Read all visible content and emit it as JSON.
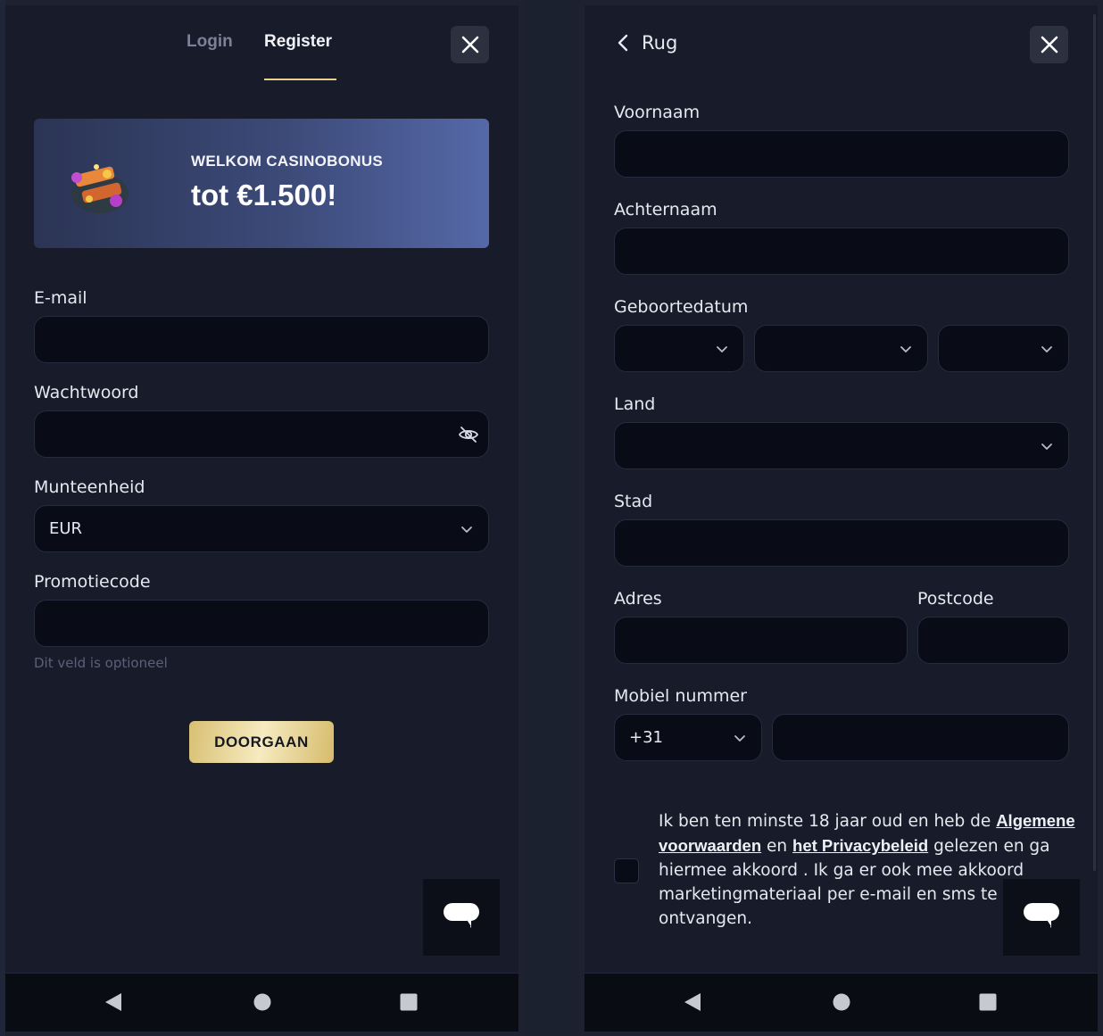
{
  "left": {
    "tabs": [
      {
        "label": "Login",
        "active": false
      },
      {
        "label": "Register",
        "active": true
      }
    ],
    "banner": {
      "subtitle": "WELKOM CASINOBONUS",
      "title": "tot €1.500!"
    },
    "fields": {
      "email_label": "E-mail",
      "password_label": "Wachtwoord",
      "currency_label": "Munteenheid",
      "currency_value": "EUR",
      "promo_label": "Promotiecode",
      "promo_hint": "Dit veld is optioneel"
    },
    "cta_label": "DOORGAAN"
  },
  "right": {
    "back_label": "Rug",
    "fields": {
      "first_name_label": "Voornaam",
      "last_name_label": "Achternaam",
      "dob_label": "Geboortedatum",
      "country_label": "Land",
      "city_label": "Stad",
      "address_label": "Adres",
      "postcode_label": "Postcode",
      "mobile_label": "Mobiel nummer",
      "dial_code": "+31"
    },
    "terms": {
      "part1": "Ik ben ten minste 18 jaar oud en heb de ",
      "link1": "Algemene voorwaarden",
      "part2": " en ",
      "link2": "het Privacybeleid",
      "part3": " gelezen en ga hiermee akkoord . Ik ga er ook mee akkoord marketingmateriaal per e-mail en sms te ontvangen."
    }
  },
  "colors": {
    "background": "#181c2a",
    "input": "#090c16",
    "accent_gold": "#e8cf8c",
    "banner_start": "#2b3454",
    "banner_end": "#5568a8"
  },
  "icons": [
    "close-icon",
    "eye-off-icon",
    "chevron-down-icon",
    "chevron-left-icon",
    "chat-icon",
    "nav-back-icon",
    "nav-home-icon",
    "nav-recents-icon",
    "gift-candy-icon"
  ]
}
